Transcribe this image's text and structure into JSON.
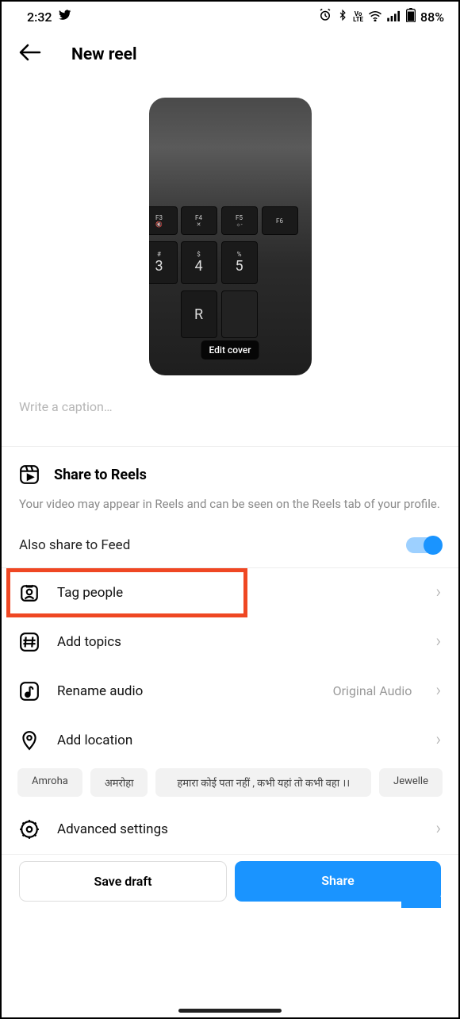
{
  "status": {
    "time": "2:32",
    "battery": "88%",
    "lte": "VoLTE"
  },
  "header": {
    "title": "New reel"
  },
  "cover": {
    "edit_label": "Edit cover",
    "keys": {
      "f3": "F3",
      "f4": "F4",
      "f5": "F5",
      "f6": "F6",
      "hash": "#",
      "dollar": "$",
      "percent": "%",
      "n3": "3",
      "n4": "4",
      "n5": "5",
      "r": "R"
    }
  },
  "caption": {
    "placeholder": "Write a caption…"
  },
  "share": {
    "title": "Share to Reels",
    "description": "Your video may appear in Reels and can be seen on the Reels tab of your profile.",
    "feed_label": "Also share to Feed"
  },
  "options": {
    "tag_people": "Tag people",
    "add_topics": "Add topics",
    "rename_audio": "Rename audio",
    "rename_meta": "Original Audio",
    "add_location": "Add location",
    "advanced": "Advanced settings"
  },
  "locations": [
    "Amroha",
    "अमरोहा",
    "हमारा कोई पता नहीं , कभी यहां तो कभी वहा ।।",
    "Jewelle"
  ],
  "buttons": {
    "save_draft": "Save draft",
    "share": "Share"
  }
}
